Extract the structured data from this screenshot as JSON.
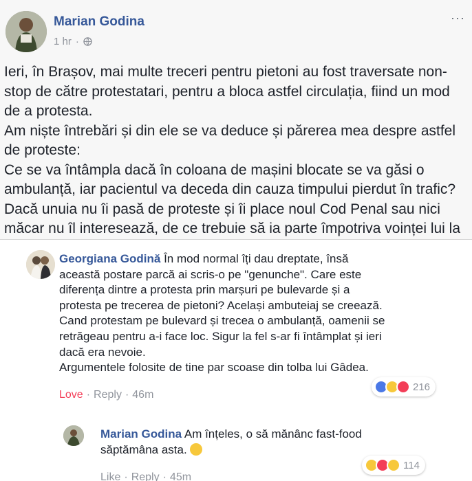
{
  "post": {
    "author": "Marian Godina",
    "time": "1 hr",
    "separator": "·",
    "privacy_icon": "globe-icon",
    "more_icon": "more-options-icon",
    "more_label": "···",
    "lines": [
      "Ieri, în Brașov, mai multe treceri pentru pietoni au fost traversate non-",
      "stop de către protestatari, pentru a bloca astfel circulația, fiind un mod",
      "de a protesta.",
      "Am niște întrebări și din ele se va deduce și părerea mea despre astfel",
      "de proteste:",
      "Ce se va întâmpla dacă în coloana de mașini blocate se va găsi o",
      "ambulanță, iar pacientul va deceda din cauza timpului pierdut în trafic?",
      "Dacă unuia nu îi pasă de proteste și îi place noul Cod Penal sau nici",
      "măcar nu îl interesează, de ce trebuie să ia parte împotriva voinței lui la"
    ]
  },
  "comments": [
    {
      "author": "Georgiana Godină",
      "lines": [
        " În mod normal îți dau dreptate, însă",
        "această postare parcă ai scris-o pe \"genunche\". Care este",
        "diferența dintre a protesta prin marșuri pe bulevarde și a",
        "protesta pe trecerea de pietoni? Același ambuteiaj se creează.",
        "Cand protestam pe bulevard și trecea o ambulanță, oamenii se",
        "retrăgeau pentru a-i face loc. Sigur la fel s-ar fi întâmplat și ieri",
        "dacă era nevoie.",
        "Argumentele folosite de tine par scoase din tolba lui Gâdea."
      ],
      "actions": {
        "react": "Love",
        "reply": "Reply",
        "time": "46m",
        "sep": "·"
      },
      "reactions": {
        "icons": [
          "like-reaction-icon",
          "haha-reaction-icon",
          "love-reaction-icon"
        ],
        "count": "216"
      }
    },
    {
      "author": "Marian Godina",
      "lines": [
        " Am înțeles, o să mănânc fast-food",
        "săptămâna asta."
      ],
      "inline_emoji": "grinning-face-icon",
      "actions": {
        "react": "Like",
        "reply": "Reply",
        "time": "45m",
        "sep": "·"
      },
      "reactions": {
        "icons": [
          "haha-reaction-icon",
          "love-reaction-icon",
          "wow-reaction-icon"
        ],
        "count": "114"
      }
    }
  ],
  "colors": {
    "link": "#365899",
    "love": "#f33e58",
    "meta": "#90949c",
    "text": "#1d2129"
  }
}
